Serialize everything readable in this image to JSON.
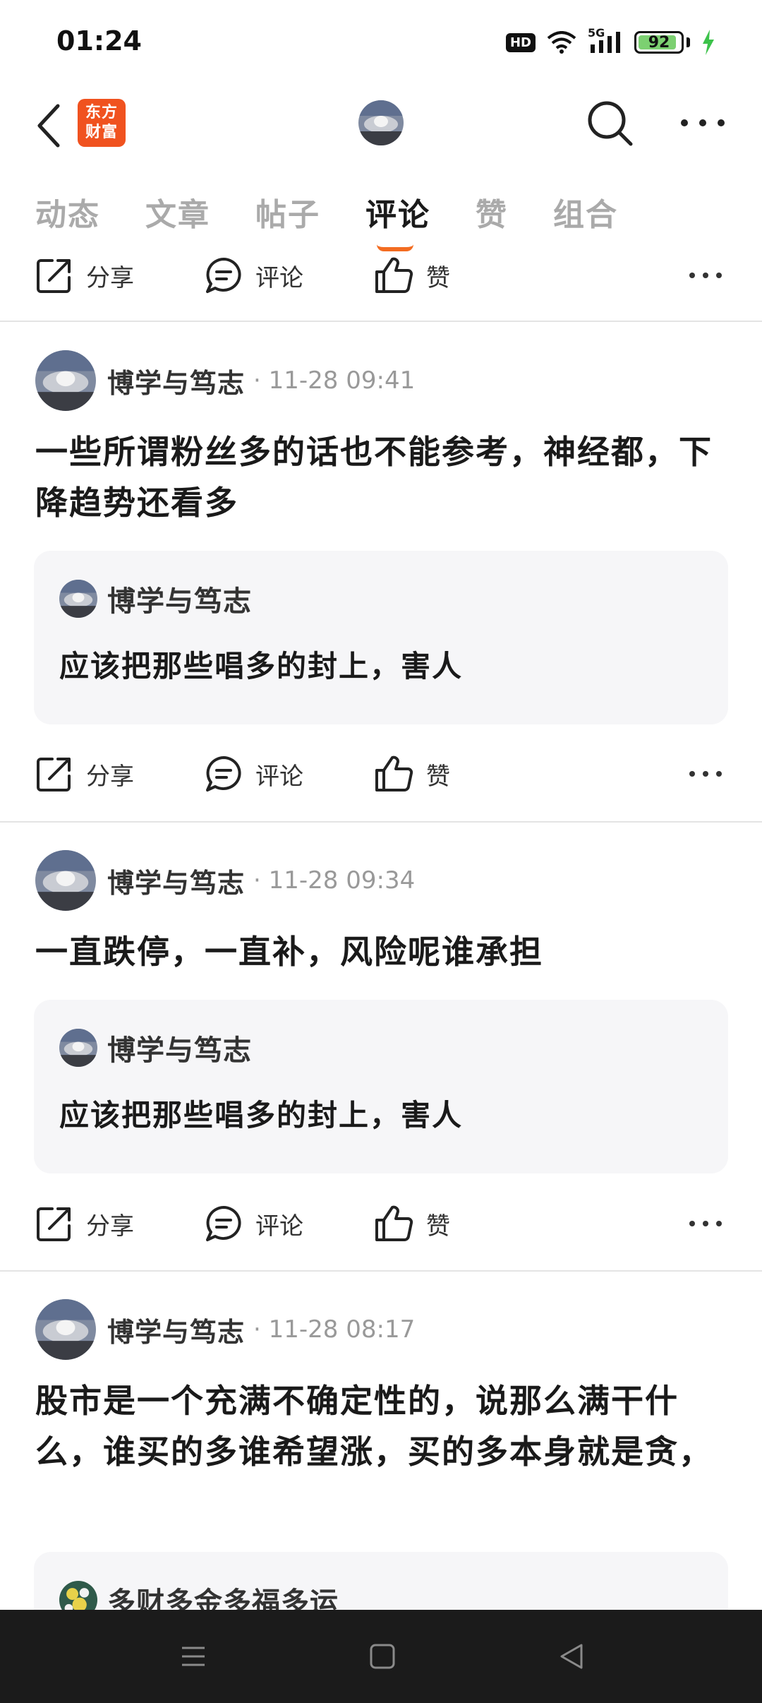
{
  "status": {
    "time": "01:24",
    "hd": "HD",
    "network": "5G",
    "battery": "92",
    "battery_level": 0.92
  },
  "header": {
    "logo_line1": "东方",
    "logo_line2": "财富"
  },
  "tabs": [
    {
      "label": "动态"
    },
    {
      "label": "文章"
    },
    {
      "label": "帖子"
    },
    {
      "label": "评论",
      "active": true
    },
    {
      "label": "赞"
    },
    {
      "label": "组合"
    }
  ],
  "actions": {
    "share": "分享",
    "comment": "评论",
    "like": "赞"
  },
  "posts": [
    {
      "author": "博学与笃志",
      "time": "· 11-28 09:41",
      "body": "一些所谓粉丝多的话也不能参考，神经都，下降趋势还看多",
      "quote_author": "博学与笃志",
      "quote_text": "应该把那些唱多的封上，害人"
    },
    {
      "author": "博学与笃志",
      "time": "· 11-28 09:34",
      "body": "一直跌停，一直补，风险呢谁承担",
      "quote_author": "博学与笃志",
      "quote_text": "应该把那些唱多的封上，害人"
    },
    {
      "author": "博学与笃志",
      "time": "· 11-28 08:17",
      "body": "股市是一个充满不确定性的，说那么满干什么，谁买的多谁希望涨，买的多本身就是贪，",
      "quote_author": "多财多金多福多运"
    }
  ],
  "colors": {
    "accent": "#f36c21",
    "logo_bg": "#f0521f",
    "battery_fill": "#7cd071"
  },
  "icons": [
    "back-icon",
    "search-icon",
    "more-icon",
    "share-icon",
    "comment-icon",
    "like-icon",
    "menu-icon",
    "home-icon",
    "nav-back-icon"
  ]
}
